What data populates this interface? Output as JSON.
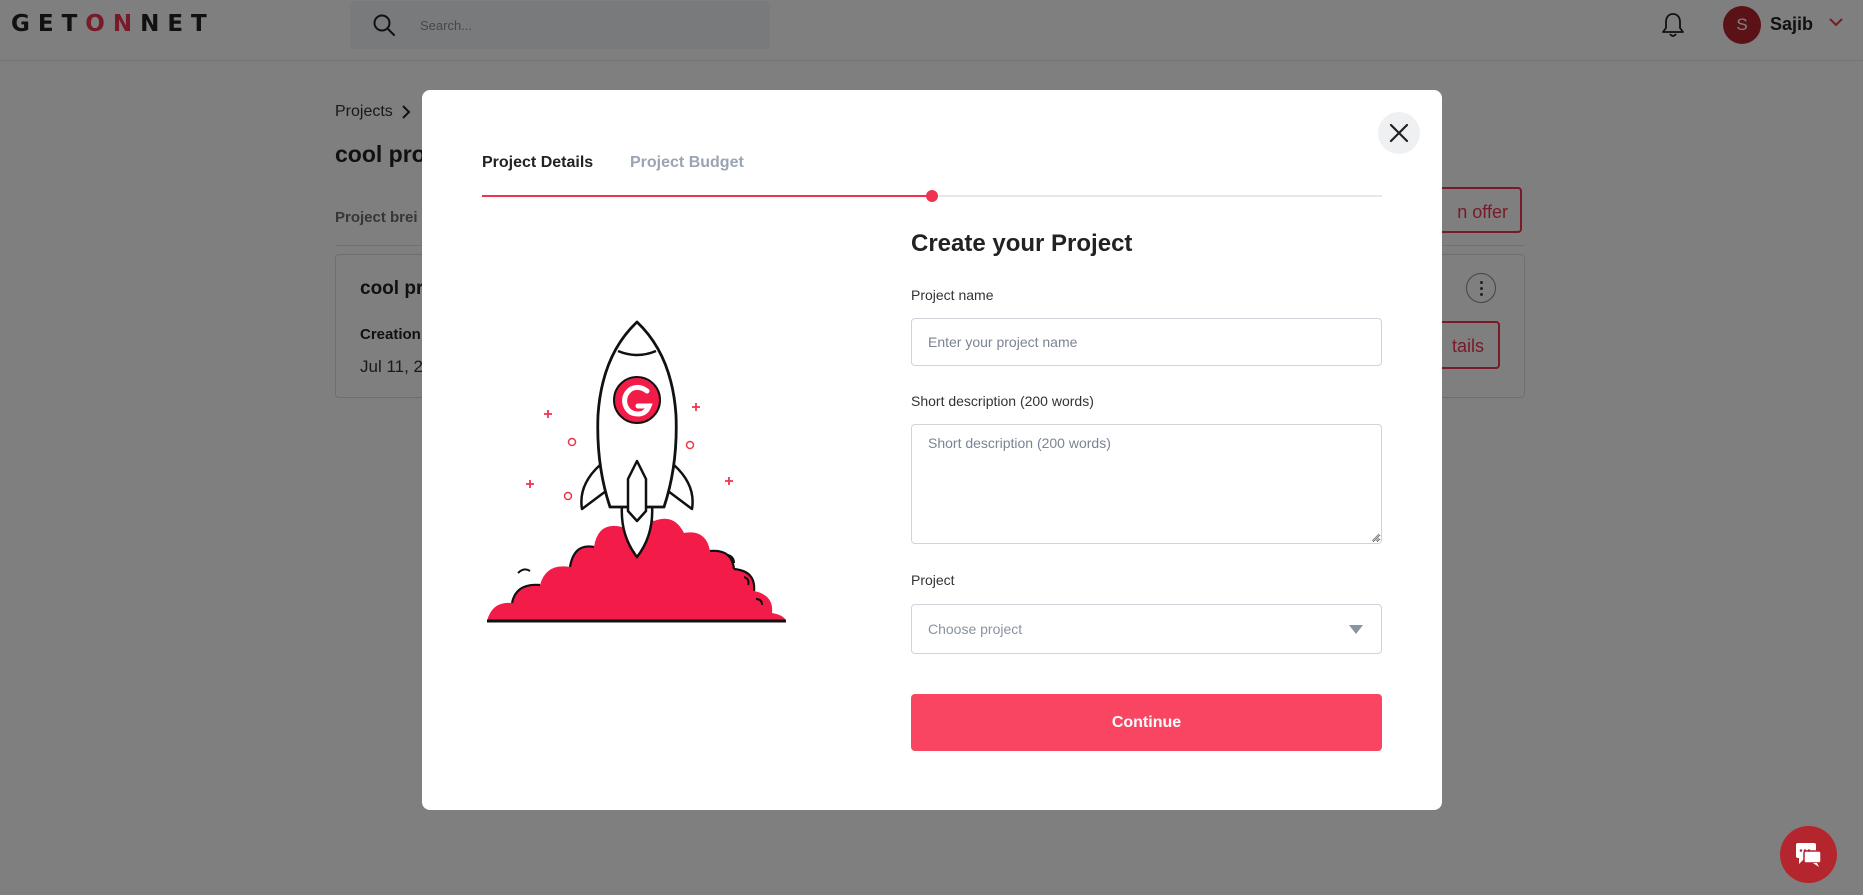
{
  "header": {
    "logo": {
      "part1": "GET",
      "part2": "ON",
      "part3": "NET"
    },
    "search_placeholder": "Search...",
    "user": {
      "avatar_initial": "S",
      "name": "Sajib"
    }
  },
  "background_page": {
    "breadcrumb": "Projects",
    "title": "cool pro",
    "tab_label": "Project brei",
    "offer_button": "n offer",
    "card": {
      "title": "cool pr",
      "creation_label": "Creation",
      "creation_date": "Jul 11, 2",
      "details_button": "tails"
    }
  },
  "modal": {
    "tabs": [
      {
        "label": "Project Details",
        "active": true
      },
      {
        "label": "Project Budget",
        "active": false
      }
    ],
    "progress": 0.5,
    "form": {
      "title": "Create your Project",
      "project_name_label": "Project name",
      "project_name_placeholder": "Enter your project name",
      "project_name_value": "",
      "short_description_label": "Short description (200 words)",
      "short_description_placeholder": "Short description (200 words)",
      "short_description_value": "",
      "project_label": "Project",
      "project_select_value": "Choose project",
      "continue_label": "Continue"
    }
  },
  "colors": {
    "brand": "#f0344f",
    "button": "#fa4562",
    "avatar": "#b5252e",
    "muted_tab": "#9aa4b2"
  },
  "icons": {
    "search": "search-icon",
    "bell": "bell-icon",
    "chevron": "chevron-down-icon",
    "close": "close-icon",
    "caret": "caret-down-icon",
    "chat": "chat-icon",
    "illustration": "rocket-launch-illustration"
  }
}
